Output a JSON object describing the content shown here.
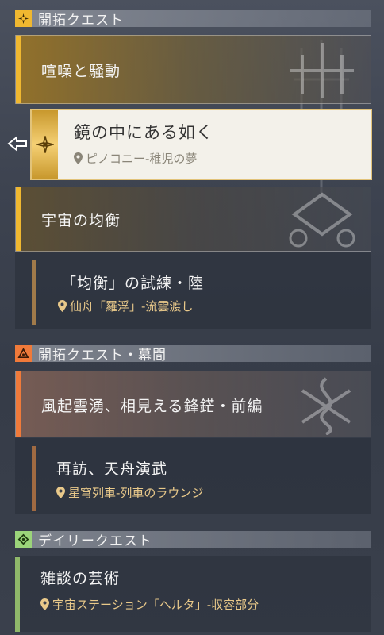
{
  "sections": {
    "trailblaze": {
      "title": "開拓クエスト",
      "icon": "trailblaze-star-icon",
      "color": "#f0b830"
    },
    "interlude": {
      "title": "開拓クエスト・幕間",
      "icon": "interlude-triangle-icon",
      "color": "#f07a3a"
    },
    "daily": {
      "title": "デイリークエスト",
      "icon": "daily-diamond-icon",
      "color": "#9bd47a"
    }
  },
  "groups": {
    "g1": {
      "title": "喧噪と騒動"
    },
    "g2": {
      "title": "宇宙の均衡"
    },
    "g3": {
      "title": "風起雲湧、相見える鋒鋩・前編"
    }
  },
  "quests": {
    "selected": {
      "title": "鏡の中にある如く",
      "location": "ピノコニー-稚児の夢"
    },
    "q2": {
      "title": "「均衡」の試練・陸",
      "location": "仙舟「羅浮」-流雲渡し"
    },
    "q3": {
      "title": "再訪、天舟演武",
      "location": "星穹列車-列車のラウンジ"
    },
    "q4": {
      "title": "雑談の芸術",
      "location": "宇宙ステーション「ヘルタ」-収容部分"
    }
  },
  "colors": {
    "gold": "#f0b830",
    "orange": "#f07a3a",
    "green": "#8fb86a",
    "brown": "#a07a4a",
    "location": "#e9c98a"
  }
}
